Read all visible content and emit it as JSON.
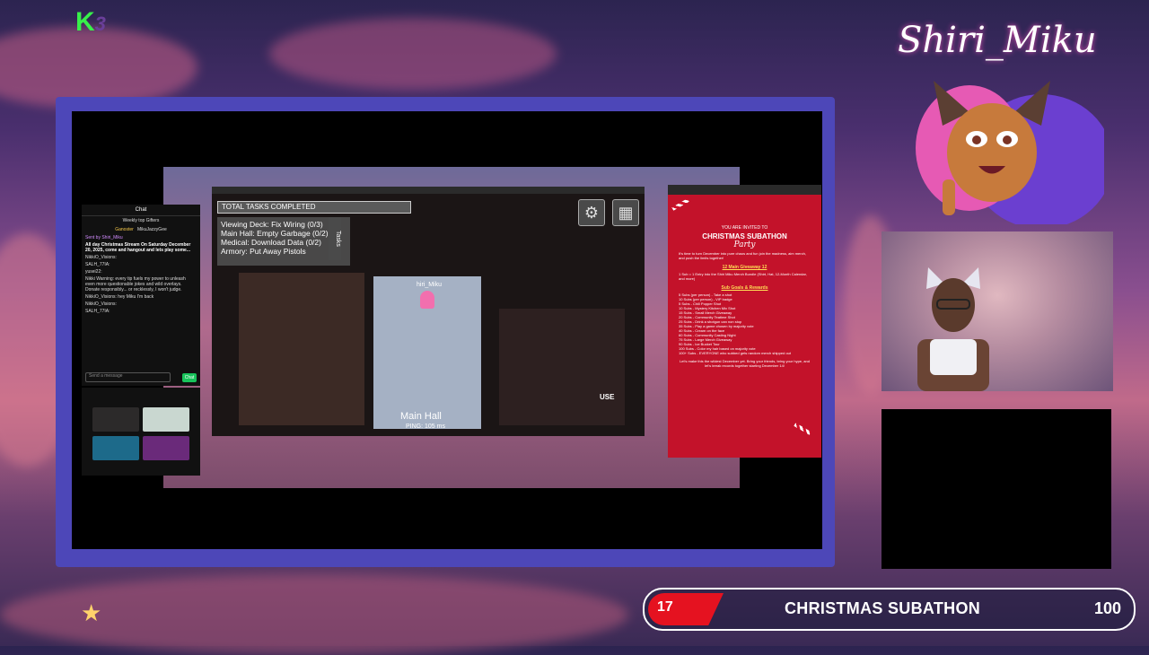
{
  "overlay": {
    "logo_k": "K",
    "logo_n": "3",
    "streamer_name": "Shiri_Miku"
  },
  "chat": {
    "header": "Chat",
    "gifters_label": "Weekly top Gifters",
    "top_gifters": [
      "Ganoster",
      "MikuJazzyGee"
    ],
    "messages": [
      "Sent by Shiri_Miku",
      "All day Christmas Stream On Saturday December 20, 2025, come and hangout and lets play some...",
      "NikkiO_Visions:",
      "SALH_77IA:",
      "yusei22:",
      "Nikki Warning: every tip fuels my power to unleash even more questionable jokes and wild overlays. Donate responsibly... or recklessly, I won't judge.",
      "NikkiO_Visions: hey Miku I'm back",
      "NikkiO_Visions:",
      "SALH_77IA:"
    ],
    "send_placeholder": "Send a message",
    "send_button": "Chat"
  },
  "game": {
    "tasks_bar": "TOTAL TASKS COMPLETED",
    "tasks_tab": "Tasks",
    "tasks": [
      "Viewing Deck: Fix Wiring (0/3)",
      "Main Hall: Empty Garbage (0/2)",
      "Medical: Download Data (0/2)",
      "Armory: Put Away Pistols"
    ],
    "player_name": "hiri_Miku",
    "room_name": "Main Hall",
    "ping": "PING: 105 ms",
    "use_label": "USE",
    "settings_icon": "gear-icon",
    "map_icon": "map-icon"
  },
  "flyer": {
    "invite": "YOU ARE INVITED TO",
    "title": "CHRISTMAS SUBATHON",
    "script": "Party",
    "intro": "It's time to turn December into pure chaos and fun join the madness, aim merch, and push the limits together!",
    "giveaway_heading": "12 Main Giveaway 12",
    "giveaway_text": "1 Sub = 1 Entry into the Shiri Miku Merch Bundle (Shirt, Hat, 12-Month Calendar, and more)",
    "goals_heading": "Sub Goals & Rewards",
    "goals": [
      "5 Subs (per person) - Take a shot",
      "10 Subs (per person) - VIP badge",
      "5 Subs - Chill Popper Shot",
      "10 Subs - Mystery Kitchen Mix Shot",
      "15 Subs - Small Merch Giveaway",
      "20 Subs - Community Teatime Shot",
      "25 Subs - Drink a shotgun can non stop",
      "35 Subs - Play a game chosen by majority vote",
      "40 Subs - Cream on the face",
      "60 Subs - Community Casting Night",
      "75 Subs - Large Merch Giveaway",
      "90 Subs - Ice Bucket Tour",
      "100 Subs - Color my hair based on majority vote",
      "100+ Subs - EVERYONE who subbed gets random merch shipped out"
    ],
    "closing": "Let's make this the wildest December yet. Bring your friends, bring your hype, and let's break records together starting December 14!"
  },
  "subathon": {
    "current": "17",
    "title": "CHRISTMAS SUBATHON",
    "goal": "100",
    "progress_fraction": 0.17
  },
  "colors": {
    "frame": "#4d47b8",
    "subathon_red": "#e51220",
    "flyer_red": "#c3122a",
    "logo_green": "#38f04a"
  }
}
